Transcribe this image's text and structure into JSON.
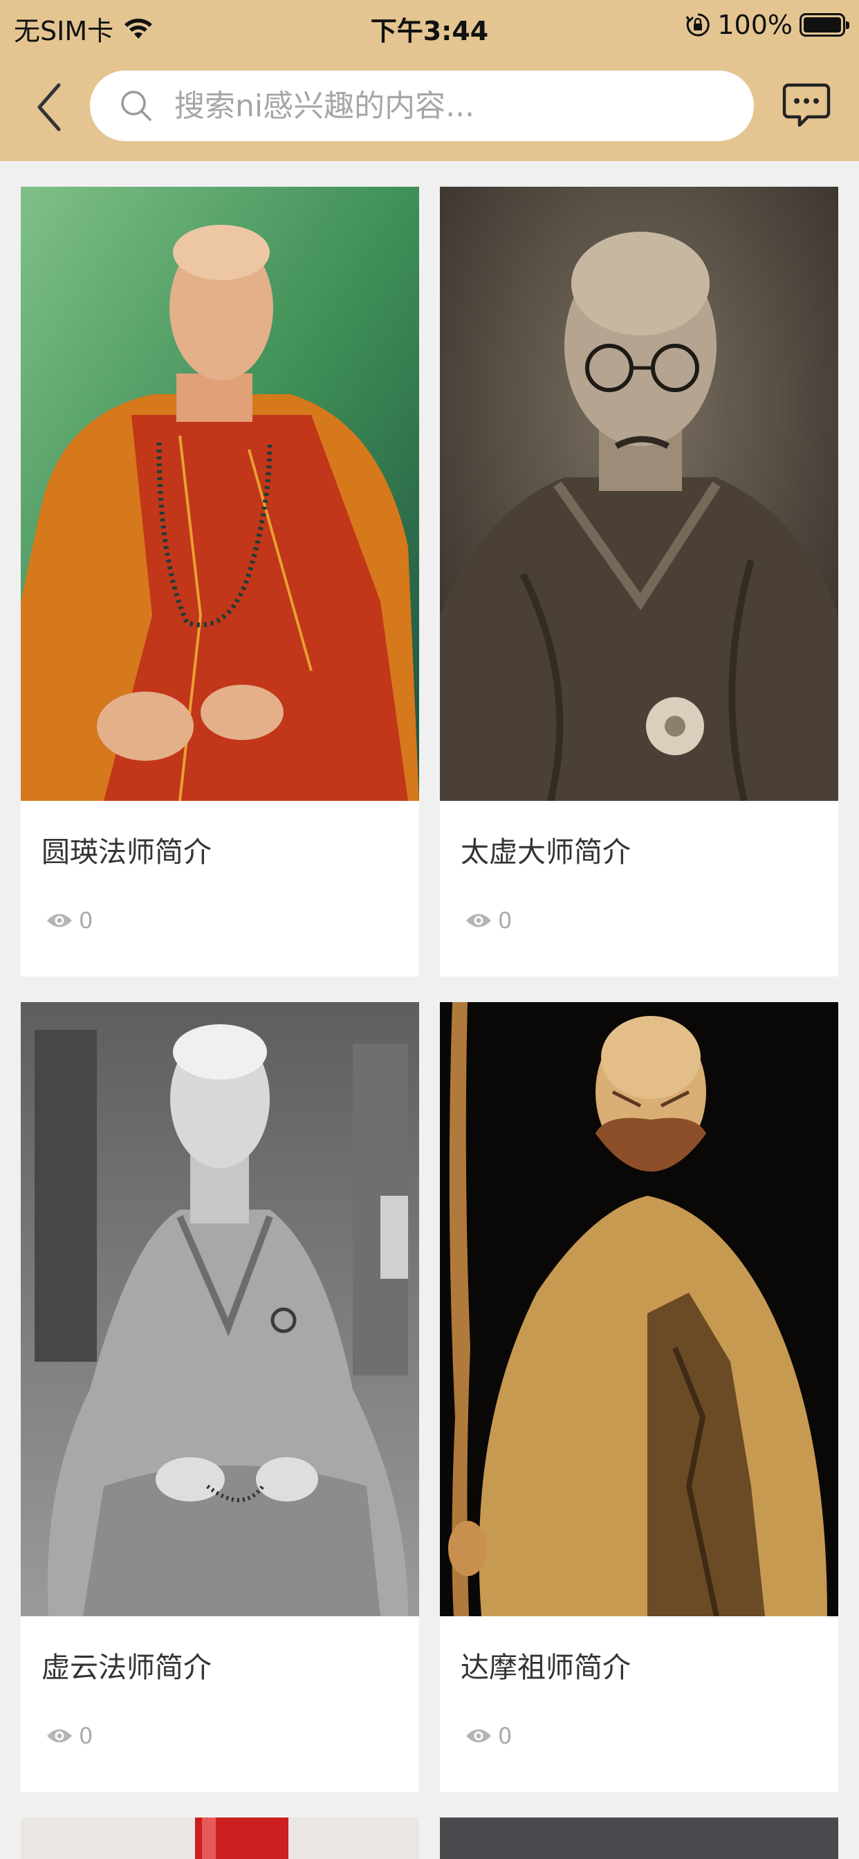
{
  "status_bar": {
    "carrier": "无SIM卡",
    "time": "下午3:44",
    "battery_percent": "100%",
    "battery_level": 1.0
  },
  "nav": {
    "back_icon": "chevron-left-icon",
    "search_placeholder": "搜索ni感兴趣的内容...",
    "search_value": "",
    "message_icon": "message-dots-icon"
  },
  "colors": {
    "header_bg": "#e4c591",
    "page_bg": "#f0f0f0",
    "card_bg": "#ffffff"
  },
  "articles": [
    {
      "title": "圆瑛法师简介",
      "views": "0",
      "image": "monk-in-orange-red-robe-photo"
    },
    {
      "title": "太虚大师简介",
      "views": "0",
      "image": "monk-with-round-glasses-sepia-photo"
    },
    {
      "title": "虚云法师简介",
      "views": "0",
      "image": "elderly-monk-seated-bw-photo"
    },
    {
      "title": "达摩祖师简介",
      "views": "0",
      "image": "bodhidharma-wood-carving-photo"
    }
  ]
}
